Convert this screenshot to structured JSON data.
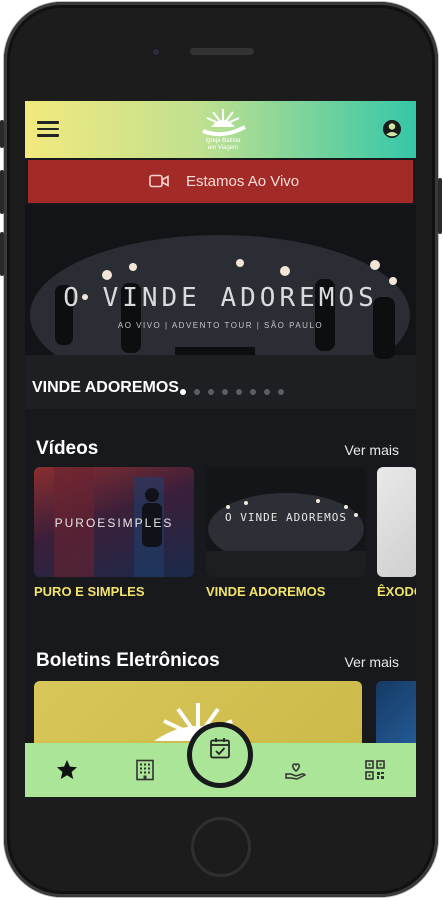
{
  "app": {
    "logo_text_line1": "Igreja Batista",
    "logo_text_line2": "em Viagem"
  },
  "live_banner": {
    "label": "Estamos Ao Vivo",
    "icon": "video-camera-icon",
    "color": "#a32b27"
  },
  "hero": {
    "artwork_title": "O VINDE ADOREMOS",
    "artwork_subtitle": "AO VIVO | ADVENTO TOUR | SÃO PAULO",
    "caption": "VINDE ADOREMOS",
    "slide_count": 8,
    "active_slide": 1
  },
  "videos": {
    "title": "Vídeos",
    "see_more": "Ver mais",
    "items": [
      {
        "label": "PURO E SIMPLES",
        "thumb_title": "PUROESIMPLES"
      },
      {
        "label": "VINDE ADOREMOS",
        "thumb_title": "O VINDE ADOREMOS"
      },
      {
        "label": "ÊXODO",
        "thumb_title": ""
      }
    ]
  },
  "bulletins": {
    "title": "Boletins Eletrônicos",
    "see_more": "Ver mais"
  },
  "bottom_nav": {
    "items": [
      "star-icon",
      "building-icon",
      "calendar-check-icon",
      "donate-hand-icon",
      "qr-code-icon"
    ],
    "active": "calendar-check-icon",
    "color": "#abe597"
  },
  "colors": {
    "accent_yellow": "#f2e46a",
    "topbar_start": "#f2e97e",
    "topbar_end": "#35c7a8",
    "background": "#17191c"
  }
}
